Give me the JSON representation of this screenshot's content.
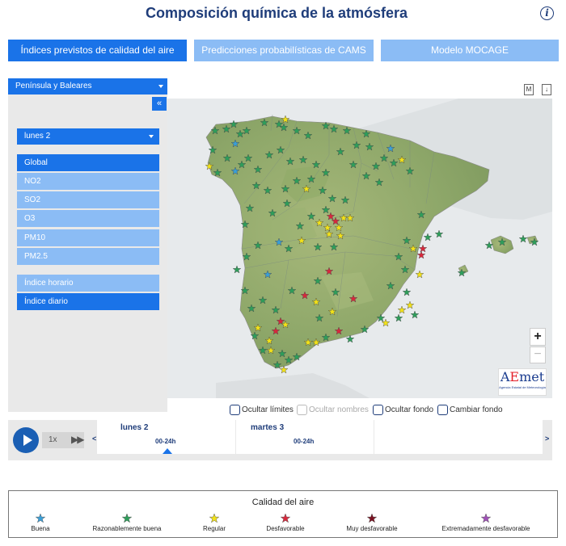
{
  "header": {
    "title": "Composición química de la atmósfera",
    "info_icon": "info-icon"
  },
  "tabs": [
    {
      "label": "Índices previstos de calidad del aire",
      "active": true
    },
    {
      "label": "Predicciones probabilísticas de CAMS",
      "active": false
    },
    {
      "label": "Modelo MOCAGE",
      "active": false
    }
  ],
  "sidebar": {
    "region_select": "Península y Baleares",
    "collapse_label": "«",
    "day_select": "lunes 2",
    "pollutants": [
      "Global",
      "NO2",
      "SO2",
      "O3",
      "PM10",
      "PM2.5"
    ],
    "active_pollutant": "Global",
    "index_types": [
      "Índice horario",
      "Índice diario"
    ],
    "active_index_type": "Índice diario"
  },
  "map_tools": {
    "tool1": "M",
    "tool2": "↓"
  },
  "zoom": {
    "in": "+",
    "out": "−"
  },
  "logo": {
    "mark_a": "A",
    "mark_e": "E",
    "mark_rest": "met",
    "subtitle": "Agencia Estatal de Meteorología"
  },
  "map_options": [
    {
      "label": "Ocultar límites",
      "enabled": true
    },
    {
      "label": "Ocultar nombres",
      "enabled": false
    },
    {
      "label": "Ocultar fondo",
      "enabled": true
    },
    {
      "label": "Cambiar fondo",
      "enabled": true
    }
  ],
  "timeline": {
    "speed": "1x",
    "prev": "<",
    "next": ">",
    "days": [
      {
        "label": "lunes 2",
        "period": "00-24h",
        "selected": true
      },
      {
        "label": "martes 3",
        "period": "00-24h",
        "selected": false
      }
    ]
  },
  "legend": {
    "title": "Calidad del aire",
    "items": [
      {
        "label": "Buena",
        "color": "#3a9fd8"
      },
      {
        "label": "Razonablemente buena",
        "color": "#2e9e5a"
      },
      {
        "label": "Regular",
        "color": "#f2e218"
      },
      {
        "label": "Desfavorable",
        "color": "#d8283c"
      },
      {
        "label": "Muy desfavorable",
        "color": "#7a1020"
      },
      {
        "label": "Extremadamente desfavorable",
        "color": "#a050b8"
      }
    ]
  }
}
